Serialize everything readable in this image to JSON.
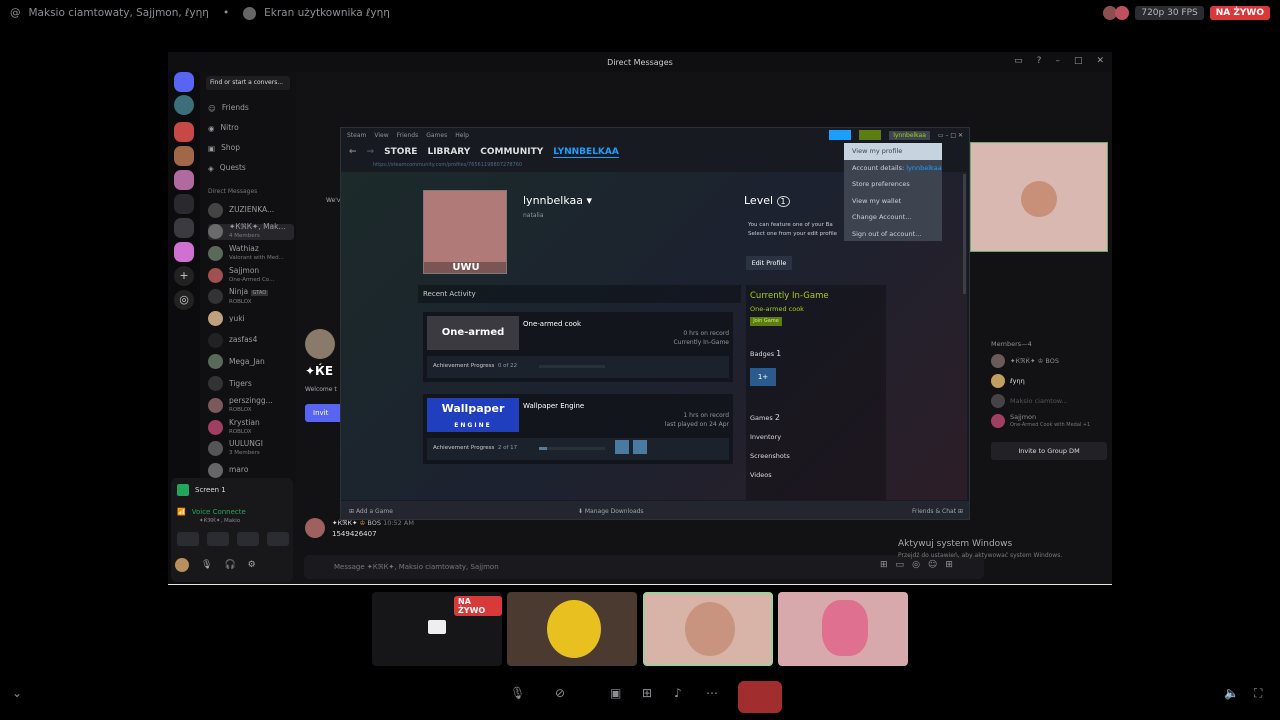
{
  "topbar": {
    "channel": "Maksio ciamtowaty, Sajjmon, ℓуηη",
    "stream_label": "Ekran użytkownika ℓуηη",
    "quality": "720p 30 FPS",
    "live": "NA ŻYWO"
  },
  "window": {
    "title": "Direct Messages"
  },
  "discord": {
    "find": "Find or start a convers...",
    "nav": [
      "Friends",
      "Nitro",
      "Shop",
      "Quests"
    ],
    "dm_header": "Direct Messages",
    "dms": [
      {
        "name": "ZUZIENKA...",
        "sub": ""
      },
      {
        "name": "✦ЌℜЌ✦, Mak...",
        "sub": "4 Members"
      },
      {
        "name": "Wathiaz",
        "sub": "Valorant with Med..."
      },
      {
        "name": "Sajjmon",
        "sub": "One-Armed Co..."
      },
      {
        "name": "Ninja",
        "sub": "ROBLOX"
      },
      {
        "name": "yuki",
        "sub": ""
      },
      {
        "name": "zasfas4",
        "sub": ""
      },
      {
        "name": "Mega_Jan",
        "sub": ""
      },
      {
        "name": "Tigers",
        "sub": ""
      },
      {
        "name": "perszingg...",
        "sub": "ROBLOX"
      },
      {
        "name": "Krystian",
        "sub": "ROBLOX"
      },
      {
        "name": "UULUNGI",
        "sub": "3 Members"
      },
      {
        "name": "maro",
        "sub": ""
      }
    ],
    "ninja_tag": "GTAO",
    "screen": "Screen 1",
    "voice": "Voice Connecte",
    "voice_sub": "✦ЌℜЌ✦, Makio",
    "message_placeholder": "Message ✦ЌℜЌ✦, Maksio ciamtowaty, Sajjmon",
    "chat_name": "✦ЌℜЌ✦",
    "chat_time": "10:52 AM",
    "chat_text": "1549426407",
    "big_title": "✦ЌЕ",
    "welcome": "Welcome t",
    "invite_btn": "Invit",
    "we": "We'v",
    "members_header": "Members—4",
    "members": [
      "✦ЌℜЌ✦ ♔ BOS",
      "ℓуηη",
      "Maksio ciamtow...",
      "Sajjmon"
    ],
    "member_sub": "One-Armed Cook with Medal +1",
    "invite_group": "Invite to Group DM",
    "bos_tag": "BOS"
  },
  "steam": {
    "menu_top": [
      "Steam",
      "View",
      "Friends",
      "Games",
      "Help"
    ],
    "nav": [
      "STORE",
      "LIBRARY",
      "COMMUNITY",
      "LYNNBELKAA"
    ],
    "url": "https://steamcommunity.com/profiles/76561198807278760",
    "user": "lynnbelkaa",
    "account_btn": "lynnbelkaa",
    "realname": "natalia",
    "avatar_text": "UWU",
    "level_label": "Level",
    "level": "1",
    "feature1": "You can feature one of your Ba",
    "feature2": "Select one from your edit profile",
    "edit_profile": "Edit Profile",
    "recent": "Recent Activity",
    "games": [
      {
        "name": "One-armed cook",
        "thumb": "One-armed cook",
        "hrs": "0 hrs on record",
        "status": "Currently In-Game",
        "ach": "Achievement Progress",
        "prog": "0 of 22",
        "pct": 0
      },
      {
        "name": "Wallpaper Engine",
        "thumb": "Wallpaper",
        "thumb2": "ENGINE",
        "hrs": "1 hrs on record",
        "status": "last played on 24 Apr",
        "ach": "Achievement Progress",
        "prog": "2 of 17",
        "pct": 12
      }
    ],
    "ingame_title": "Currently In-Game",
    "ingame_game": "One-armed cook",
    "join": "Join Game",
    "badges": "Badges",
    "badges_n": "1",
    "badge_icon": "1+",
    "games_label": "Games",
    "games_n": "2",
    "links": [
      "Inventory",
      "Screenshots",
      "Videos"
    ],
    "footer_add": "Add a Game",
    "footer_dl": "Manage Downloads",
    "footer_chat": "Friends & Chat",
    "menu": [
      "View my profile",
      "Account details:",
      "Store preferences",
      "View my wallet",
      "Change Account...",
      "Sign out of account..."
    ],
    "menu_account": "lynnbelkaa"
  },
  "windows_watermark": {
    "title": "Aktywuj system Windows",
    "sub": "Przejdź do ustawień, aby aktywować system Windows."
  },
  "tiles": {
    "live": "NA ŻYWO"
  },
  "colors": {
    "steam_blue": "#1a9fff",
    "steam_green": "#a3cf06",
    "live_red": "#d83a3a",
    "blurple": "#5865f2"
  }
}
